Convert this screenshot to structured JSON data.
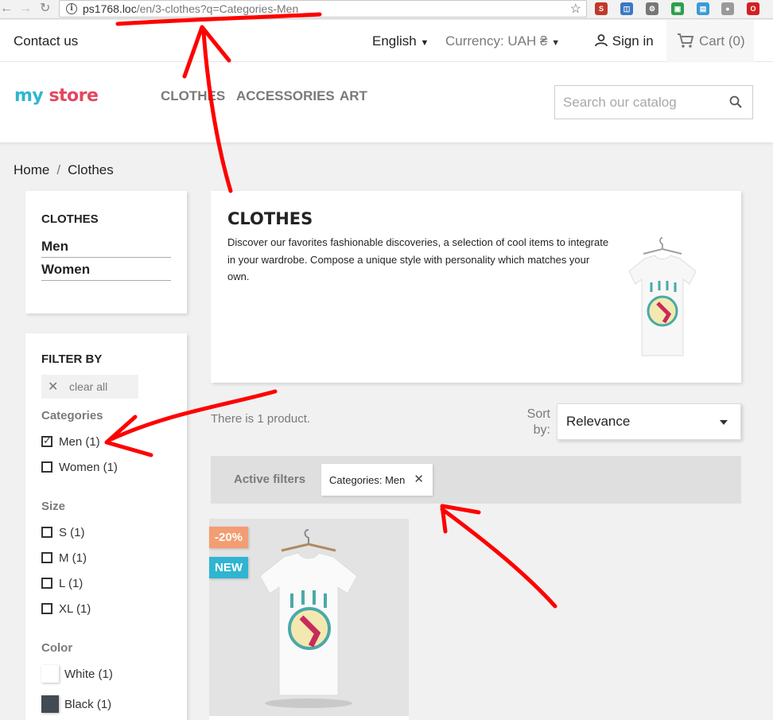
{
  "browser": {
    "url_host": "ps1768.loc",
    "url_path": "/en/3-clothes?q=Categories-Men",
    "back_icon": "arrow-left-icon",
    "forward_icon": "arrow-right-icon",
    "reload_icon": "reload-icon",
    "extensions": [
      {
        "name": "seo-extension-icon",
        "color": "#c0392b",
        "glyph": "S"
      },
      {
        "name": "extension-icon-2",
        "color": "#3a78c3",
        "glyph": "◫"
      },
      {
        "name": "settings-extension-icon",
        "color": "#777777",
        "glyph": "⚙"
      },
      {
        "name": "extension-icon-4",
        "color": "#2e9e4f",
        "glyph": "▣"
      },
      {
        "name": "extension-icon-5",
        "color": "#3a9bd5",
        "glyph": "▤"
      },
      {
        "name": "globe-extension-icon",
        "color": "#9a9a9a",
        "glyph": "●"
      },
      {
        "name": "opera-extension-icon",
        "color": "#d42020",
        "glyph": "O"
      }
    ]
  },
  "topnav": {
    "contact": "Contact us",
    "language": "English",
    "currency": "Currency: UAH ₴",
    "sign_in": "Sign in",
    "cart": "Cart (0)"
  },
  "header": {
    "logo_my": "my",
    "logo_store": "store",
    "menu": [
      "CLOTHES",
      "ACCESSORIES",
      "ART"
    ],
    "search_placeholder": "Search our catalog"
  },
  "breadcrumb": {
    "home": "Home",
    "current": "Clothes"
  },
  "category_block": {
    "title": "CLOTHES",
    "links": [
      "Men",
      "Women"
    ]
  },
  "filters": {
    "title": "FILTER BY",
    "clear_all": "clear all",
    "categories": {
      "title": "Categories",
      "options": [
        {
          "label": "Men (1)",
          "checked": true
        },
        {
          "label": "Women (1)",
          "checked": false
        }
      ]
    },
    "size": {
      "title": "Size",
      "options": [
        {
          "label": "S (1)",
          "checked": false
        },
        {
          "label": "M (1)",
          "checked": false
        },
        {
          "label": "L (1)",
          "checked": false
        },
        {
          "label": "XL (1)",
          "checked": false
        }
      ]
    },
    "color": {
      "title": "Color",
      "options": [
        {
          "label": "White (1)",
          "swatch": "#ffffff"
        },
        {
          "label": "Black (1)",
          "swatch": "#434a54"
        }
      ]
    }
  },
  "category": {
    "title": "CLOTHES",
    "description": "Discover our favorites fashionable discoveries, a selection of cool items to integrate in your wardrobe. Compose a unique style with personality which matches your own."
  },
  "listing": {
    "count": "There is 1 product.",
    "sort_label": "Sort by:",
    "sort_value": "Relevance",
    "active_filters_title": "Active filters",
    "active_filter": "Categories: Men"
  },
  "product": {
    "discount_badge": "-20%",
    "new_badge": "NEW"
  },
  "colors": {
    "annotation_red": "#ff0000",
    "accent_blue": "#2fb5d2",
    "discount_orange": "#f39d72"
  }
}
